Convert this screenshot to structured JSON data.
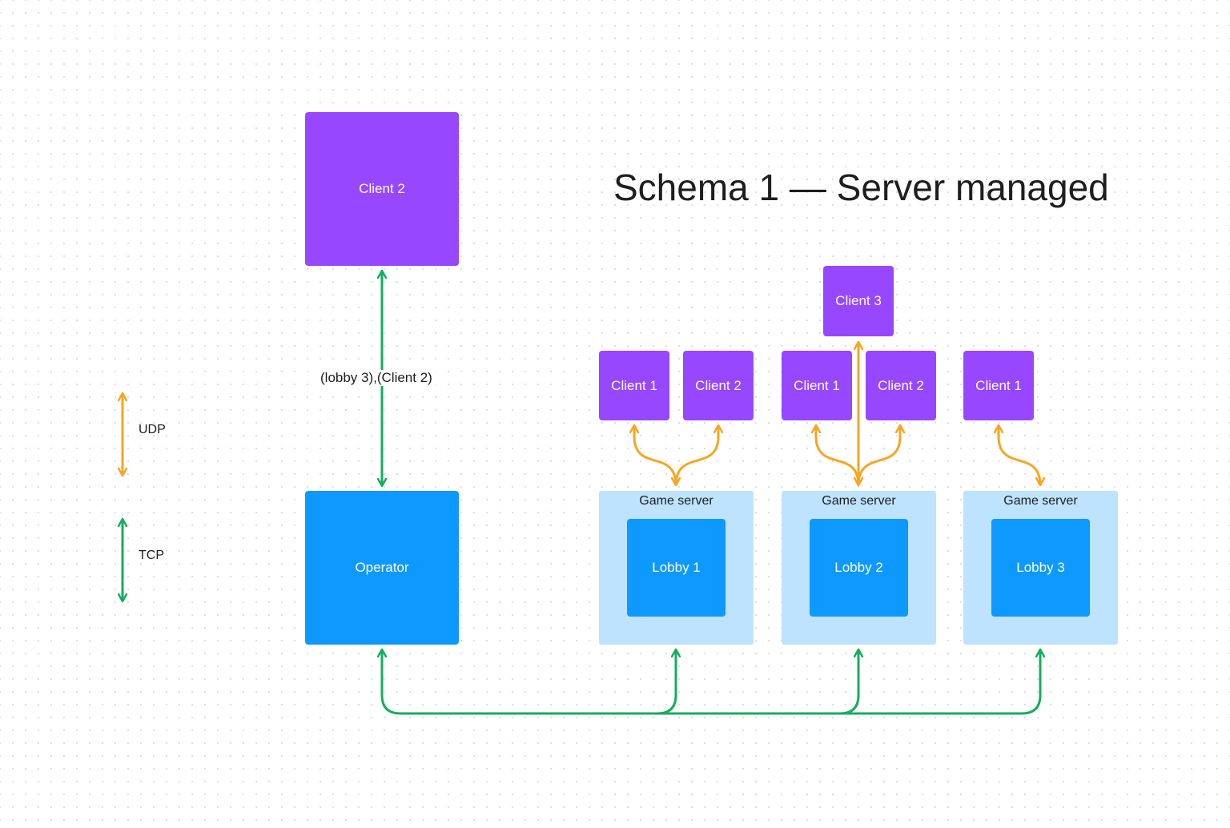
{
  "title": "Schema 1 — Server managed",
  "colors": {
    "client": "#9747ff",
    "operator": "#0d99ff",
    "lobby": "#0d99ff",
    "game_server": "#bde3ff",
    "udp": "#f5a623",
    "tcp": "#14ae5c"
  },
  "legend": {
    "udp_label": "UDP",
    "tcp_label": "TCP"
  },
  "main": {
    "client_label": "Client 2",
    "operator_label": "Operator",
    "message_label": "(lobby 3),(Client 2)"
  },
  "servers": [
    {
      "label": "Game server",
      "lobby": "Lobby 1",
      "clients": [
        "Client 1",
        "Client 2"
      ]
    },
    {
      "label": "Game server",
      "lobby": "Lobby 2",
      "clients": [
        "Client 1",
        "Client 2",
        "Client 3"
      ]
    },
    {
      "label": "Game server",
      "lobby": "Lobby 3",
      "clients": [
        "Client 1"
      ]
    }
  ]
}
